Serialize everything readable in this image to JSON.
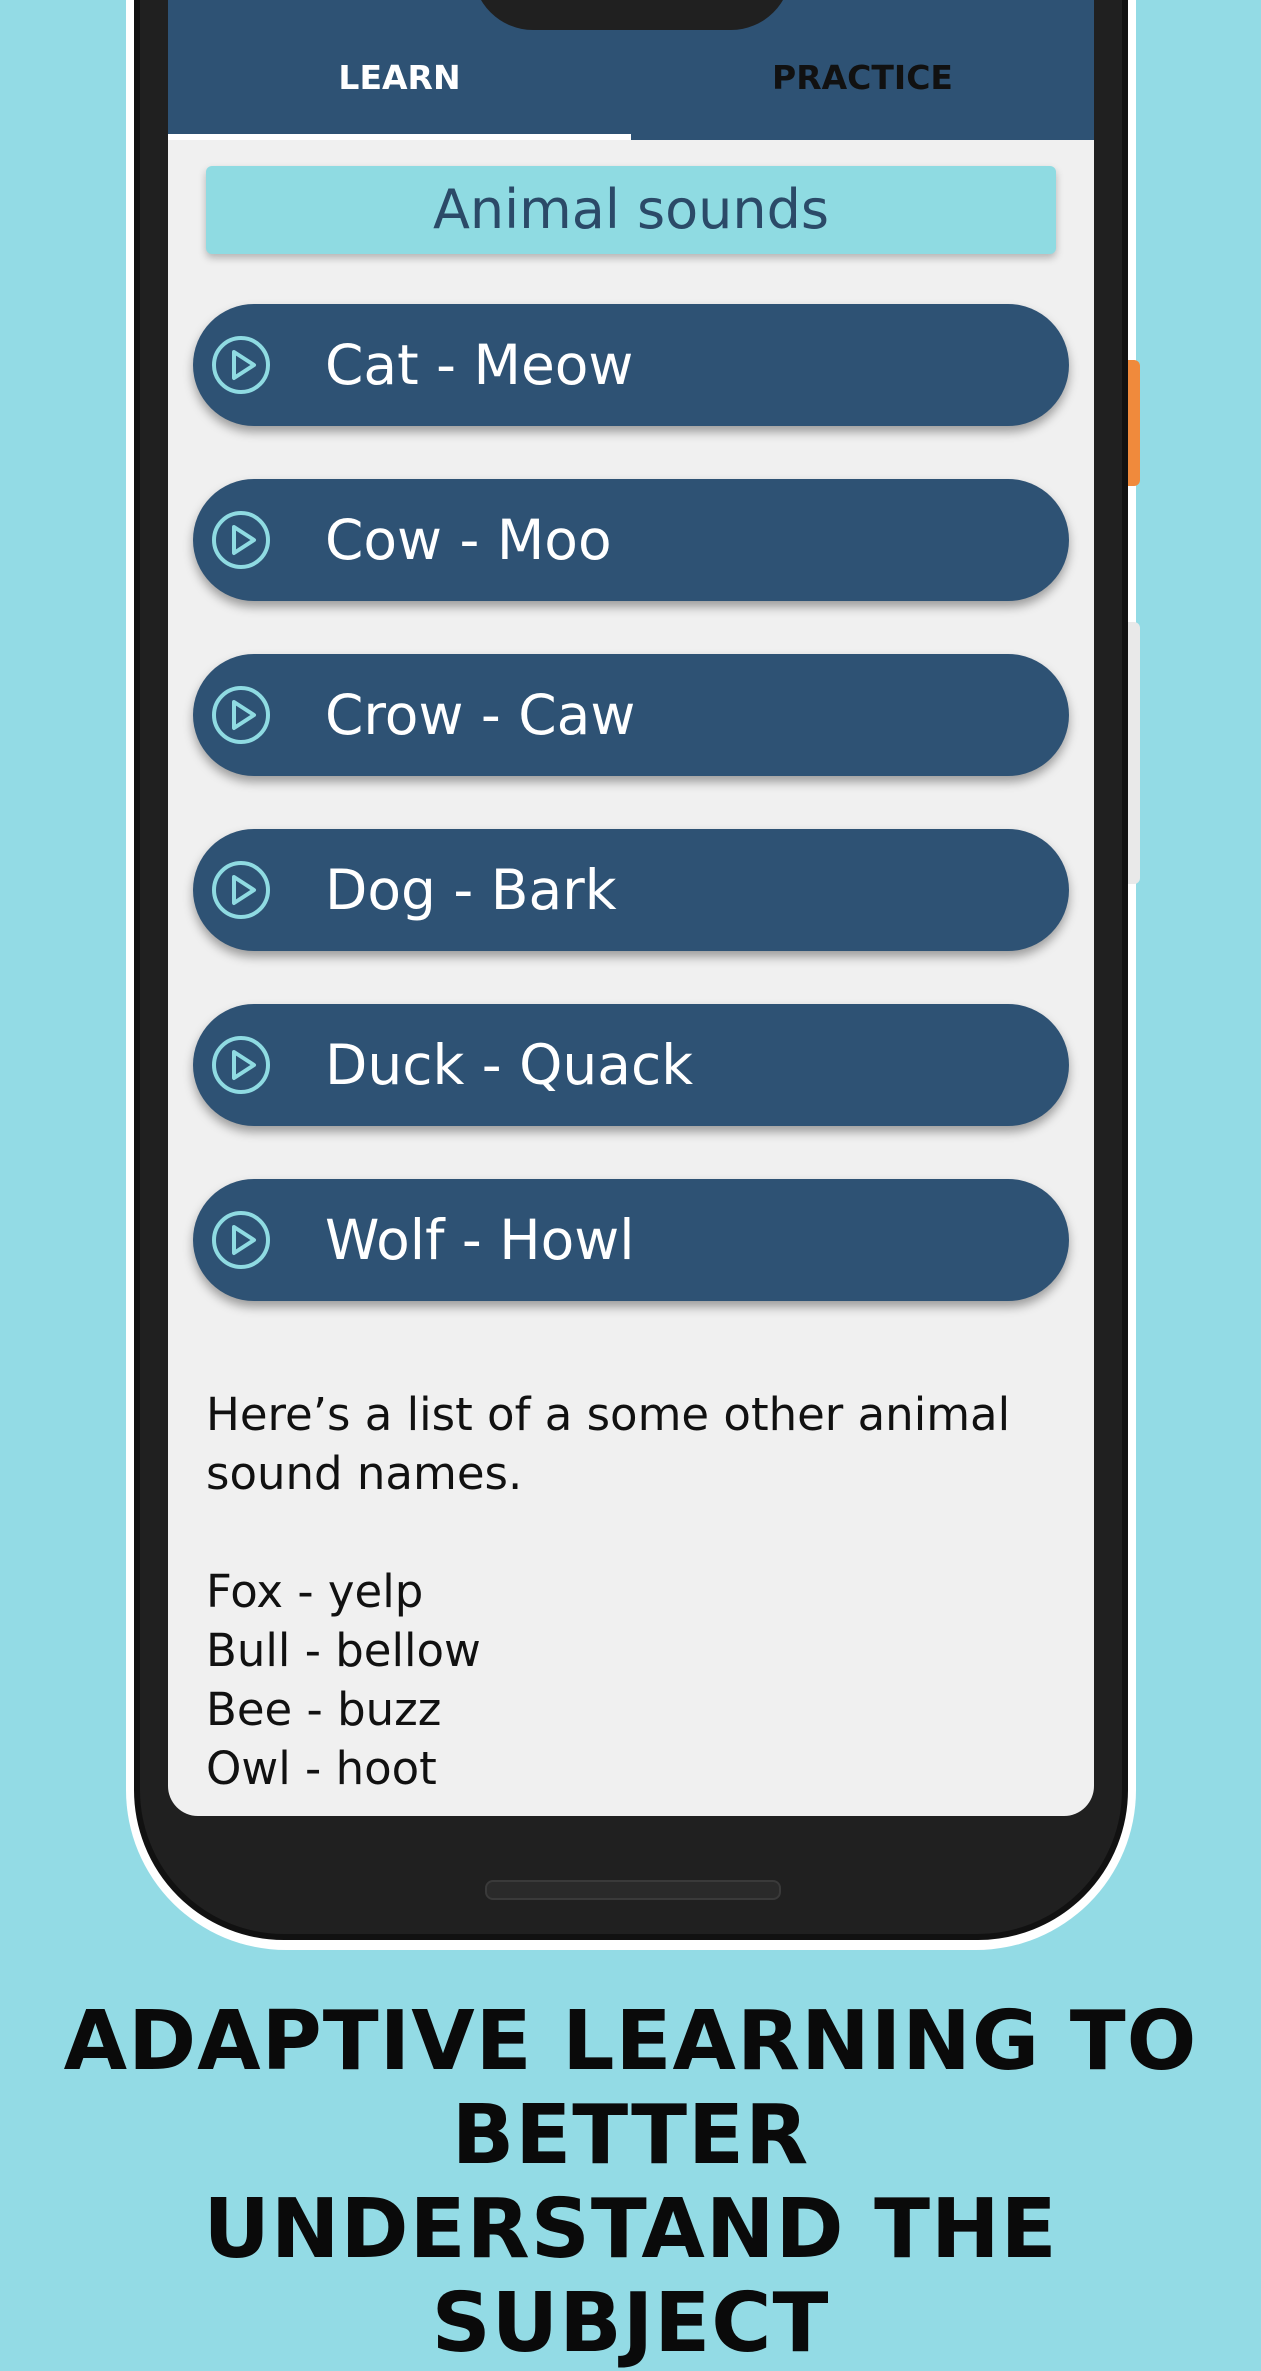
{
  "tabs": {
    "learn_label": "LEARN",
    "practice_label": "PRACTICE",
    "active": "LEARN"
  },
  "section_title": "Animal sounds",
  "sound_buttons": [
    {
      "label": "Cat - Meow",
      "icon": "play-circle-icon"
    },
    {
      "label": "Cow - Moo",
      "icon": "play-circle-icon"
    },
    {
      "label": "Crow - Caw",
      "icon": "play-circle-icon"
    },
    {
      "label": "Dog - Bark",
      "icon": "play-circle-icon"
    },
    {
      "label": "Duck - Quack",
      "icon": "play-circle-icon"
    },
    {
      "label": "Wolf - Howl",
      "icon": "play-circle-icon"
    }
  ],
  "info": {
    "intro": "Here’s a list of a some other animal sound names.",
    "other_sounds": [
      "Fox - yelp",
      "Bull - bellow",
      "Bee - buzz",
      "Owl - hoot"
    ]
  },
  "caption": {
    "line1": "ADAPTIVE LEARNING TO BETTER",
    "line2": "UNDERSTAND THE SUBJECT"
  },
  "colors": {
    "background": "#93dbe5",
    "primary": "#2e5274",
    "title_card": "#8fdbe2",
    "icon_accent": "#8fdbe2"
  }
}
